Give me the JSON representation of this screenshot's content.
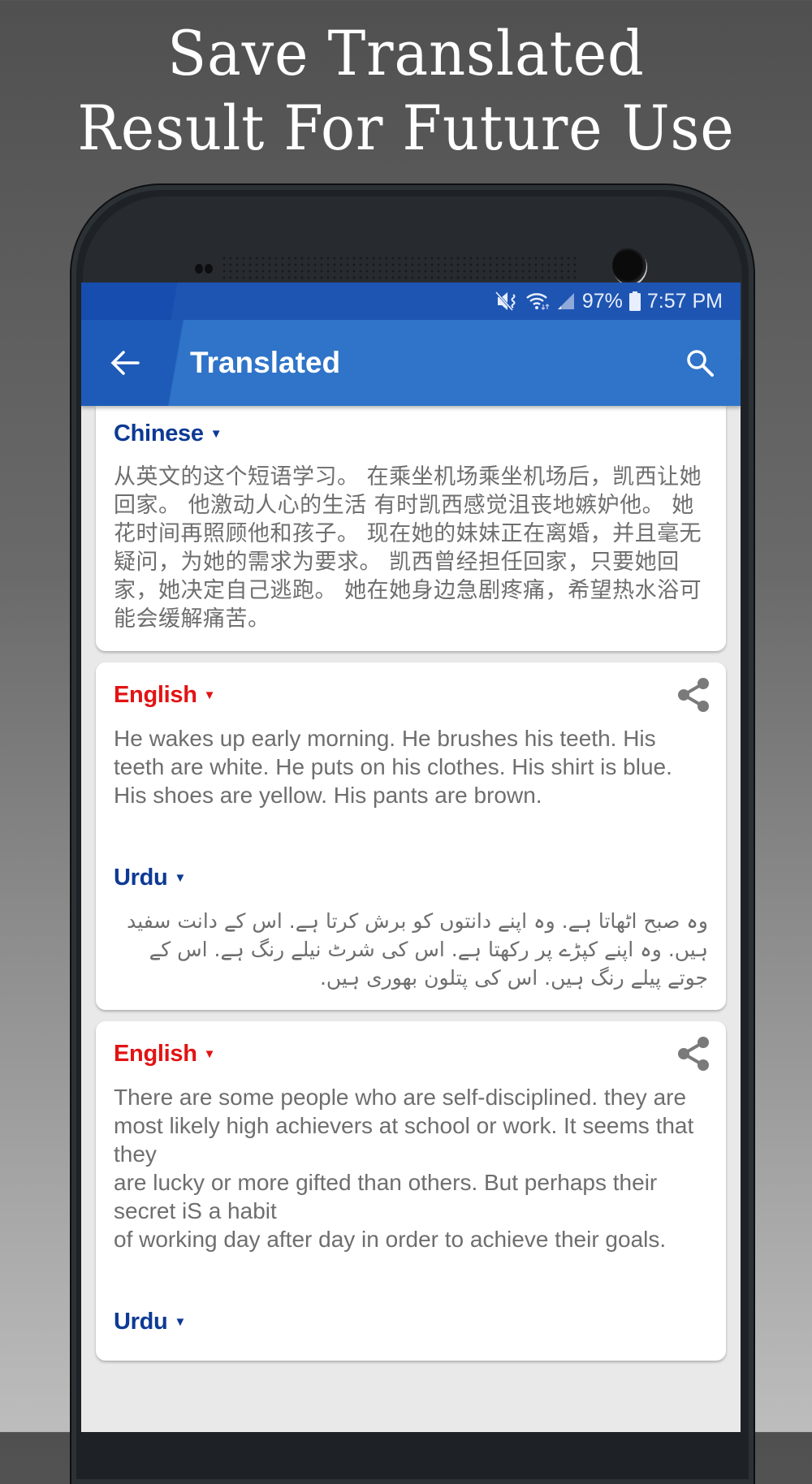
{
  "headline": {
    "line1": "Save Translated",
    "line2": "Result For Future Use"
  },
  "status_bar": {
    "icons": [
      "vibrate-mute-icon",
      "wifi-icon",
      "signal-icon",
      "battery-icon"
    ],
    "battery": "97%",
    "time": "7:57 PM"
  },
  "app_bar": {
    "back_icon": "arrow-left-icon",
    "title": "Translated",
    "search_icon": "search-icon"
  },
  "colors": {
    "appbar": "#2f74c8",
    "statusbar": "#1e55b3",
    "source_lang": "#e21313",
    "target_lang": "#0d3a94",
    "body_text": "#6e6e6e"
  },
  "cards": [
    {
      "target_lang": "Chinese",
      "target_text": "从英文的这个短语学习。 在乘坐机场乘坐机场后，凯西让她回家。 他激动人心的生活 有时凯西感觉沮丧地嫉妒他。 她花时间再照顾他和孩子。 现在她的妹妹正在离婚，并且毫无疑问，为她的需求为要求。 凯西曾经担任回家，只要她回家，她决定自己逃跑。 她在她身边急剧疼痛，希望热水浴可能会缓解痛苦。"
    },
    {
      "source_lang": "English",
      "source_text": "He wakes up early morning. He brushes his teeth. His teeth are white. He puts on his clothes. His shirt is blue. His shoes are yellow. His pants are brown.",
      "target_lang": "Urdu",
      "target_text": "وہ صبح اٹھاتا ہے. وہ اپنے دانتوں کو برش کرتا ہے. اس کے دانت سفید ہیں. وہ اپنے کپڑے پر رکھتا ہے. اس کی شرٹ نیلے رنگ ہے. اس کے جوتے پیلے رنگ ہیں. اس کی پتلون بھوری ہیں.",
      "share_icon": "share-icon"
    },
    {
      "source_lang": "English",
      "source_text": "There are some people who are self-disciplined. they are\nmost likely high achievers at school or work. It seems that they\nare lucky or more gifted than others. But perhaps their secret iS a habit\nof working day after day in order to achieve their goals.",
      "target_lang": "Urdu",
      "share_icon": "share-icon"
    }
  ]
}
